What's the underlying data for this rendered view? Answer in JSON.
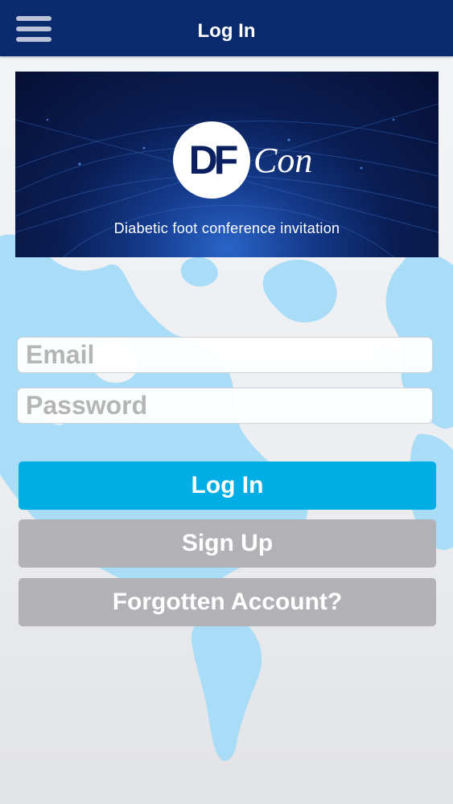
{
  "header": {
    "title": "Log In",
    "menu_icon": "hamburger-menu-icon",
    "background_color": "#0a2a6e"
  },
  "banner": {
    "logo_mark": "DF",
    "logo_wordmark": "Con",
    "tagline": "Diabetic foot conference invitation"
  },
  "form": {
    "email_placeholder": "Email",
    "email_value": "",
    "password_placeholder": "Password",
    "password_value": ""
  },
  "actions": {
    "login_label": "Log In",
    "signup_label": "Sign Up",
    "forgot_label": "Forgotten Account?"
  },
  "colors": {
    "primary_button": "#00aee6",
    "secondary_button": "#b2b2b6",
    "map": "#a9dcf6"
  }
}
